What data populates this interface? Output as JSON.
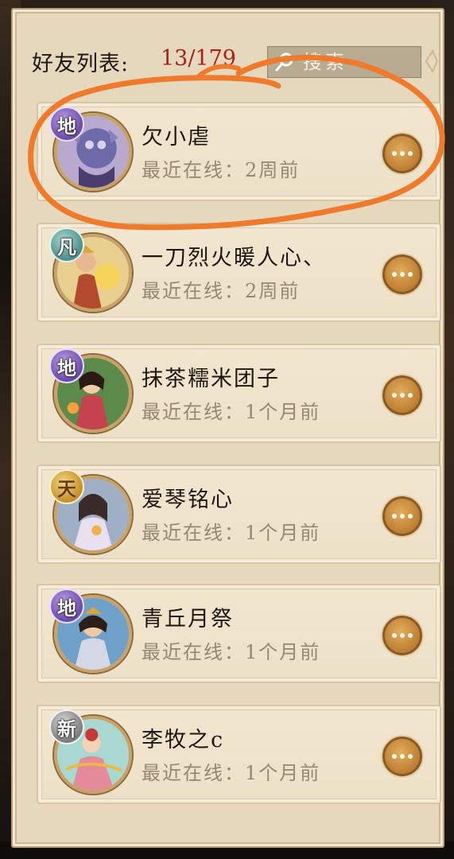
{
  "header": {
    "title": "好友列表:",
    "count": "13/179"
  },
  "search": {
    "placeholder": "搜索"
  },
  "friends": [
    {
      "name": "欠小虐",
      "status": "最近在线：2周前",
      "rank": "地",
      "avatar_icon": "beast-avatar-icon"
    },
    {
      "name": "一刀烈火暖人心、",
      "status": "最近在线：2周前",
      "rank": "凡",
      "avatar_icon": "warrior-avatar-icon"
    },
    {
      "name": "抹茶糯米团子",
      "status": "最近在线：1个月前",
      "rank": "地",
      "avatar_icon": "maiden-avatar-icon"
    },
    {
      "name": "爱琴铭心",
      "status": "最近在线：1个月前",
      "rank": "天",
      "avatar_icon": "sorceress-avatar-icon"
    },
    {
      "name": "青丘月祭",
      "status": "最近在线：1个月前",
      "rank": "地",
      "avatar_icon": "hero-avatar-icon"
    },
    {
      "name": "李牧之c",
      "status": "最近在线：1个月前",
      "rank": "新",
      "avatar_icon": "dancer-avatar-icon"
    }
  ],
  "colors": {
    "count_red": "#a8211b",
    "highlight_orange": "#f07a2c",
    "panel_bg": "#e6d8bd"
  }
}
